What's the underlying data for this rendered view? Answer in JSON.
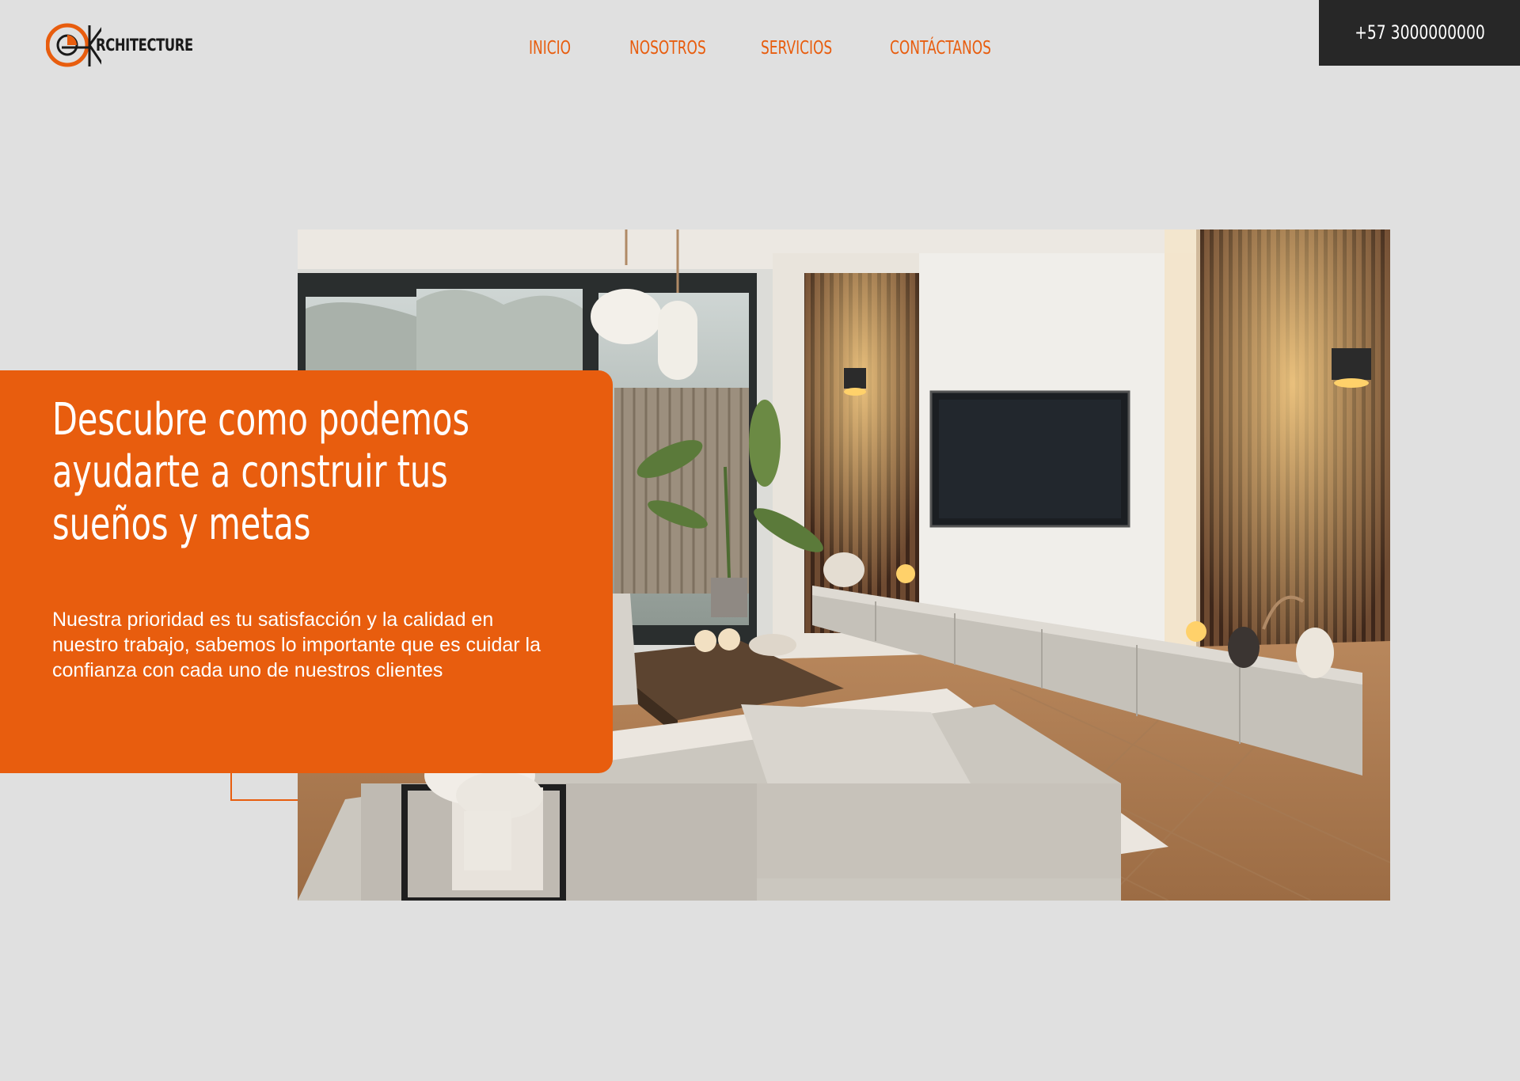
{
  "brand": {
    "name": "RCHITECTURE",
    "accent_color": "#e85d0e",
    "dark_color": "#272727"
  },
  "nav": {
    "items": [
      {
        "label": "INICIO"
      },
      {
        "label": "NOSOTROS"
      },
      {
        "label": "SERVICIOS"
      },
      {
        "label": "CONTÁCTANOS"
      }
    ]
  },
  "header": {
    "phone": "+57 3000000000"
  },
  "hero": {
    "headline": "Descubre como podemos\nayudarte a construir tus\nsueños  y metas",
    "body": "Nuestra prioridad es tu satisfacción y la calidad en nuestro trabajo, sabemos lo importante que es cuidar la confianza con cada uno de nuestros clientes",
    "image_subject": "living-room-interior-photo"
  }
}
